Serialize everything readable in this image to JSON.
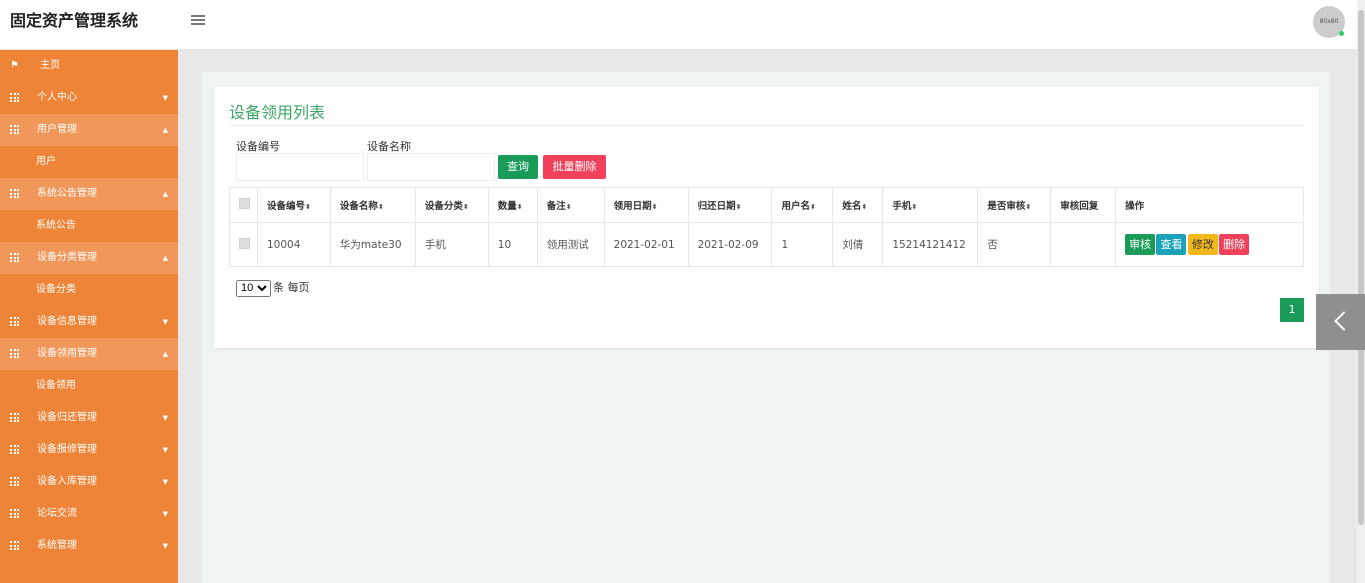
{
  "header": {
    "title": "固定资产管理系统",
    "avatar_text": "80x80"
  },
  "sidebar": {
    "items": [
      {
        "label": "主页",
        "icon": "flag-icon",
        "caret": ""
      },
      {
        "label": "个人中心",
        "icon": "grid-icon",
        "caret": "▼"
      },
      {
        "label": "用户管理",
        "icon": "grid-icon",
        "caret": "▲"
      },
      {
        "label": "用户",
        "icon": "",
        "caret": ""
      },
      {
        "label": "系统公告管理",
        "icon": "grid-icon",
        "caret": "▲"
      },
      {
        "label": "系统公告",
        "icon": "",
        "caret": ""
      },
      {
        "label": "设备分类管理",
        "icon": "grid-icon",
        "caret": "▲"
      },
      {
        "label": "设备分类",
        "icon": "",
        "caret": ""
      },
      {
        "label": "设备信息管理",
        "icon": "grid-icon",
        "caret": "▼"
      },
      {
        "label": "设备领用管理",
        "icon": "grid-icon",
        "caret": "▲"
      },
      {
        "label": "设备领用",
        "icon": "",
        "caret": ""
      },
      {
        "label": "设备归还管理",
        "icon": "grid-icon",
        "caret": "▼"
      },
      {
        "label": "设备报修管理",
        "icon": "grid-icon",
        "caret": "▼"
      },
      {
        "label": "设备入库管理",
        "icon": "grid-icon",
        "caret": "▼"
      },
      {
        "label": "论坛交流",
        "icon": "grid-icon",
        "caret": "▼"
      },
      {
        "label": "系统管理",
        "icon": "grid-icon",
        "caret": "▼"
      }
    ]
  },
  "panel": {
    "title": "设备领用列表",
    "filters": {
      "code_label": "设备编号",
      "code_value": "",
      "name_label": "设备名称",
      "name_value": ""
    },
    "query_label": "查询",
    "batch_delete_label": "批量删除"
  },
  "table": {
    "sort_glyph": "⬍",
    "headers": [
      "设备编号",
      "设备名称",
      "设备分类",
      "数量",
      "备注",
      "领用日期",
      "归还日期",
      "用户名",
      "姓名",
      "手机",
      "是否审核",
      "审核回复",
      "操作"
    ],
    "rows": [
      {
        "code": "10004",
        "name": "华为mate30",
        "category": "手机",
        "quantity": "10",
        "remark": "领用测试",
        "borrow_date": "2021-02-01",
        "return_date": "2021-02-09",
        "username": "1",
        "realname": "刘倩",
        "phone": "15214121412",
        "audited": "否",
        "reply": ""
      }
    ],
    "actions": {
      "audit": "审核",
      "view": "查看",
      "edit": "修改",
      "delete": "删除"
    }
  },
  "pagination": {
    "per_page_value": "10",
    "per_page_suffix": "条 每页",
    "current_page": "1"
  },
  "colors": {
    "sidebar": "#ee8438",
    "accent_green": "#1a9b57",
    "danger": "#f0405a",
    "info": "#1aa3b8",
    "warning": "#f5b81b"
  }
}
